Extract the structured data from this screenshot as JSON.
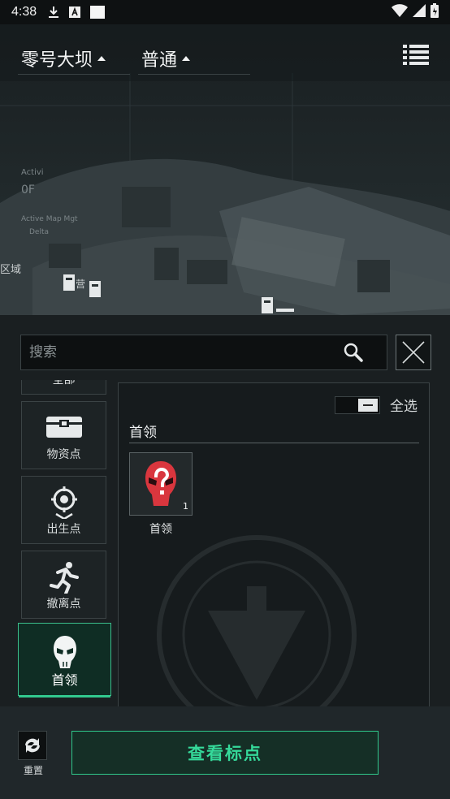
{
  "status_bar": {
    "time": "4:38",
    "icons": [
      "download-icon",
      "a-badge-icon",
      "blank-notification-icon",
      "wifi-icon",
      "signal-icon",
      "battery-icon"
    ]
  },
  "header": {
    "map_selector": "零号大坝",
    "difficulty_selector": "普通",
    "menu_icon": "list-menu-icon"
  },
  "map": {
    "labels": [
      "Activi",
      "0F",
      "Active Map Mgt",
      "Delta",
      "区域",
      "营"
    ]
  },
  "search": {
    "placeholder": "搜索"
  },
  "categories": [
    {
      "label": "全部",
      "icon": "all-icon"
    },
    {
      "label": "物资点",
      "icon": "supply-crate-icon"
    },
    {
      "label": "出生点",
      "icon": "spawn-point-icon"
    },
    {
      "label": "撤离点",
      "icon": "extraction-runner-icon"
    },
    {
      "label": "首领",
      "icon": "boss-skull-icon",
      "active": true
    }
  ],
  "content": {
    "select_all_label": "全选",
    "section_title": "首领",
    "items": [
      {
        "label": "首领",
        "count": "1",
        "icon": "red-mask-question-icon"
      }
    ]
  },
  "footer": {
    "reset_label": "重置",
    "view_label": "查看标点"
  },
  "colors": {
    "accent": "#31c98e",
    "boss_red": "#d9363e",
    "panel_bg": "#1a1f21"
  }
}
